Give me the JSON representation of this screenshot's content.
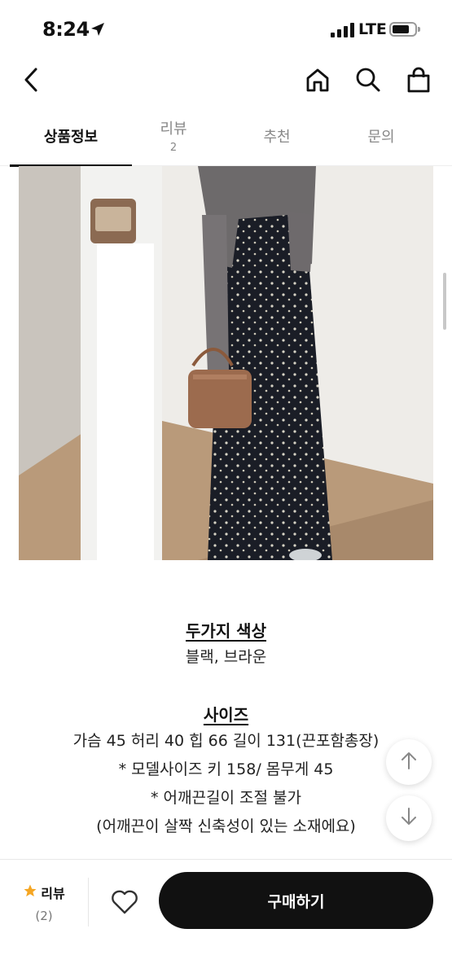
{
  "status": {
    "time": "8:24",
    "network": "LTE"
  },
  "tabs": [
    {
      "label": "상품정보",
      "count": ""
    },
    {
      "label": "리뷰",
      "count": "2"
    },
    {
      "label": "추천",
      "count": ""
    },
    {
      "label": "문의",
      "count": ""
    }
  ],
  "description": {
    "color_title": "두가지 색상",
    "color_value": "블랙, 브라운",
    "size_title": "사이즈",
    "size_lines": [
      "가슴 45 허리 40 힙 66 길이 131(끈포함총장)",
      "* 모델사이즈 키 158/ 몸무게 45",
      "* 어깨끈길이 조절 불가",
      "(어깨끈이 살짝 신축성이 있는 소재에요)"
    ]
  },
  "bottom": {
    "review_label": "리뷰",
    "review_count": "(2)",
    "buy_label": "구매하기"
  },
  "colors": {
    "accent": "#F5A623",
    "primary": "#111111"
  },
  "icons": [
    "back-arrow-icon",
    "home-icon",
    "search-icon",
    "shopping-bag-icon",
    "star-icon",
    "heart-icon",
    "arrow-up-icon",
    "arrow-down-icon",
    "location-arrow-icon"
  ]
}
